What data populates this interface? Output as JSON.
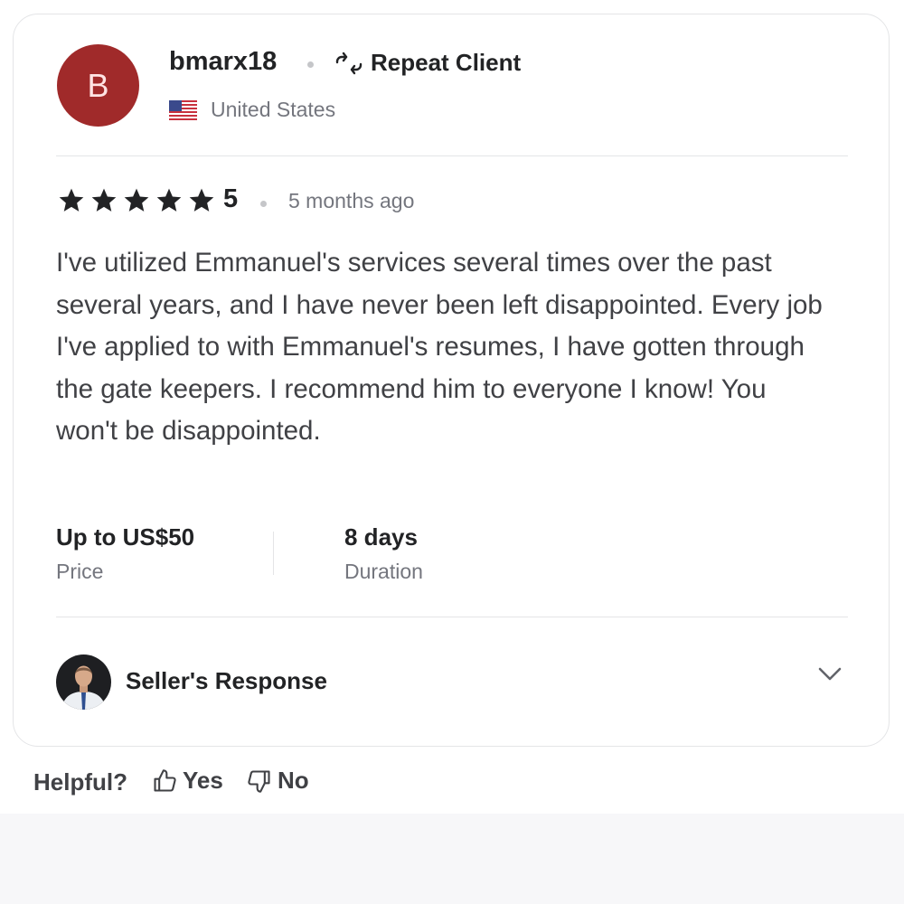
{
  "review": {
    "avatar_letter": "B",
    "username": "bmarx18",
    "badge": {
      "label": "Repeat Client",
      "icon": "repeat-icon"
    },
    "country": {
      "name": "United States",
      "icon": "us-flag-icon"
    },
    "rating": {
      "value": "5",
      "stars": 5
    },
    "time_ago": "5 months ago",
    "text": "I've utilized Emmanuel's services several times over the past several years, and I have never been left disappointed. Every job I've applied to with Emmanuel's resumes, I have gotten through the gate keepers. I recommend him to everyone I know! You won't be disappointed.",
    "price": {
      "value": "Up to US$50",
      "label": "Price"
    },
    "duration": {
      "value": "8 days",
      "label": "Duration"
    },
    "seller_response": {
      "label": "Seller's Response",
      "icon": "chevron-down-icon"
    }
  },
  "feedback": {
    "question": "Helpful?",
    "yes_label": "Yes",
    "no_label": "No"
  },
  "colors": {
    "avatar_bg": "#a02a2a",
    "text_primary": "#222325",
    "text_secondary": "#74767e",
    "border": "#e4e5e7"
  }
}
